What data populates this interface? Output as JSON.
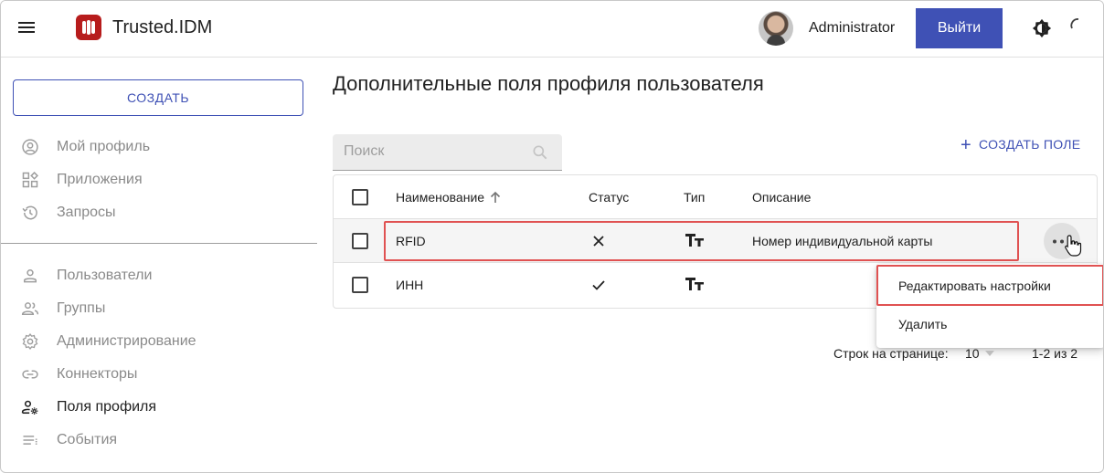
{
  "header": {
    "app_title": "Trusted.IDM",
    "username": "Administrator",
    "logout_label": "Выйти"
  },
  "sidebar": {
    "create_label": "Создать",
    "items_top": [
      {
        "label": "Мой профиль",
        "icon": "account-circle-icon"
      },
      {
        "label": "Приложения",
        "icon": "apps-icon"
      },
      {
        "label": "Запросы",
        "icon": "history-icon"
      }
    ],
    "items_bottom": [
      {
        "label": "Пользователи",
        "icon": "person-icon"
      },
      {
        "label": "Группы",
        "icon": "group-icon"
      },
      {
        "label": "Администрирование",
        "icon": "gear-icon"
      },
      {
        "label": "Коннекторы",
        "icon": "link-icon"
      },
      {
        "label": "Поля профиля",
        "icon": "person-settings-icon",
        "active": true
      },
      {
        "label": "События",
        "icon": "list-icon"
      }
    ]
  },
  "main": {
    "page_title": "Дополнительные поля профиля пользователя",
    "search_placeholder": "Поиск",
    "create_field_label": "Создать поле",
    "table": {
      "headers": {
        "name": "Наименование",
        "status": "Статус",
        "type": "Тип",
        "description": "Описание"
      },
      "rows": [
        {
          "name": "RFID",
          "status": "inactive",
          "type": "text",
          "description": "Номер индивидуальной карты"
        },
        {
          "name": "ИНН",
          "status": "active",
          "type": "text",
          "description": ""
        }
      ]
    },
    "context_menu": {
      "items": [
        "Редактировать настройки",
        "Удалить"
      ]
    },
    "pagination": {
      "rows_per_page_label": "Строк на странице:",
      "rows_per_page": "10",
      "range": "1-2 из 2"
    }
  },
  "colors": {
    "primary": "#3f51b5",
    "logo": "#b71c1c",
    "highlight": "#e05252"
  }
}
